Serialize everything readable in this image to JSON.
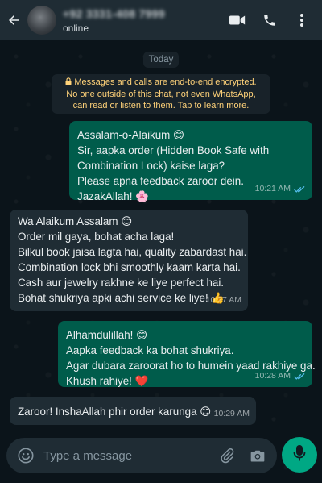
{
  "header": {
    "contact_name": "+92 3331-408 7999",
    "status": "online",
    "icons": [
      "back-arrow-icon",
      "video-call-icon",
      "voice-call-icon",
      "more-options-icon"
    ]
  },
  "chat": {
    "date_chip": "Today",
    "encryption_notice": {
      "line1": "Messages and calls are end-to-end encrypted.",
      "line2": "No one outside of this chat, not even WhatsApp,",
      "line3": "can read or listen to them. Tap to learn more."
    },
    "messages": [
      {
        "direction": "outgoing",
        "lines": [
          "Assalam-o-Alaikum 😊",
          "Sir, aapka order (Hidden Book Safe with",
          "Combination Lock) kaise laga?",
          "Please apna feedback zaroor dein.",
          "JazakAllah! 🌸"
        ],
        "time": "10:21 AM",
        "read": true
      },
      {
        "direction": "incoming",
        "lines": [
          "Wa Alaikum Assalam 😊",
          "Order mil gaya, bohat acha laga!",
          "Bilkul book jaisa lagta hai, quality zabardast hai.",
          "Combination lock bhi smoothly kaam karta hai.",
          "Cash aur jewelry rakhne ke liye perfect hai.",
          "Bohat shukriya apki achi service ke liye! 👍"
        ],
        "time": "10:27 AM"
      },
      {
        "direction": "outgoing",
        "lines": [
          "Alhamdulillah! 😊",
          "Aapka feedback ka bohat shukriya.",
          "Agar dubara zaroorat ho to humein yaad rakhiye ga.",
          "Khush rahiye! ❤️"
        ],
        "time": "10:28 AM",
        "read": true
      },
      {
        "direction": "incoming",
        "lines": [
          "Zaroor! InshaAllah phir order karunga 😊"
        ],
        "time": "10:29 AM"
      }
    ]
  },
  "composer": {
    "placeholder": "Type a message",
    "icons": [
      "emoji-icon",
      "attach-icon",
      "camera-icon",
      "mic-icon"
    ]
  },
  "colors": {
    "header_bg": "#1f2c34",
    "chat_bg": "#0b141a",
    "outgoing_bubble": "#005c4b",
    "incoming_bubble": "#1f2c34",
    "notice_text": "#ffd279",
    "accent": "#00a884",
    "read_ticks": "#53bdeb"
  }
}
